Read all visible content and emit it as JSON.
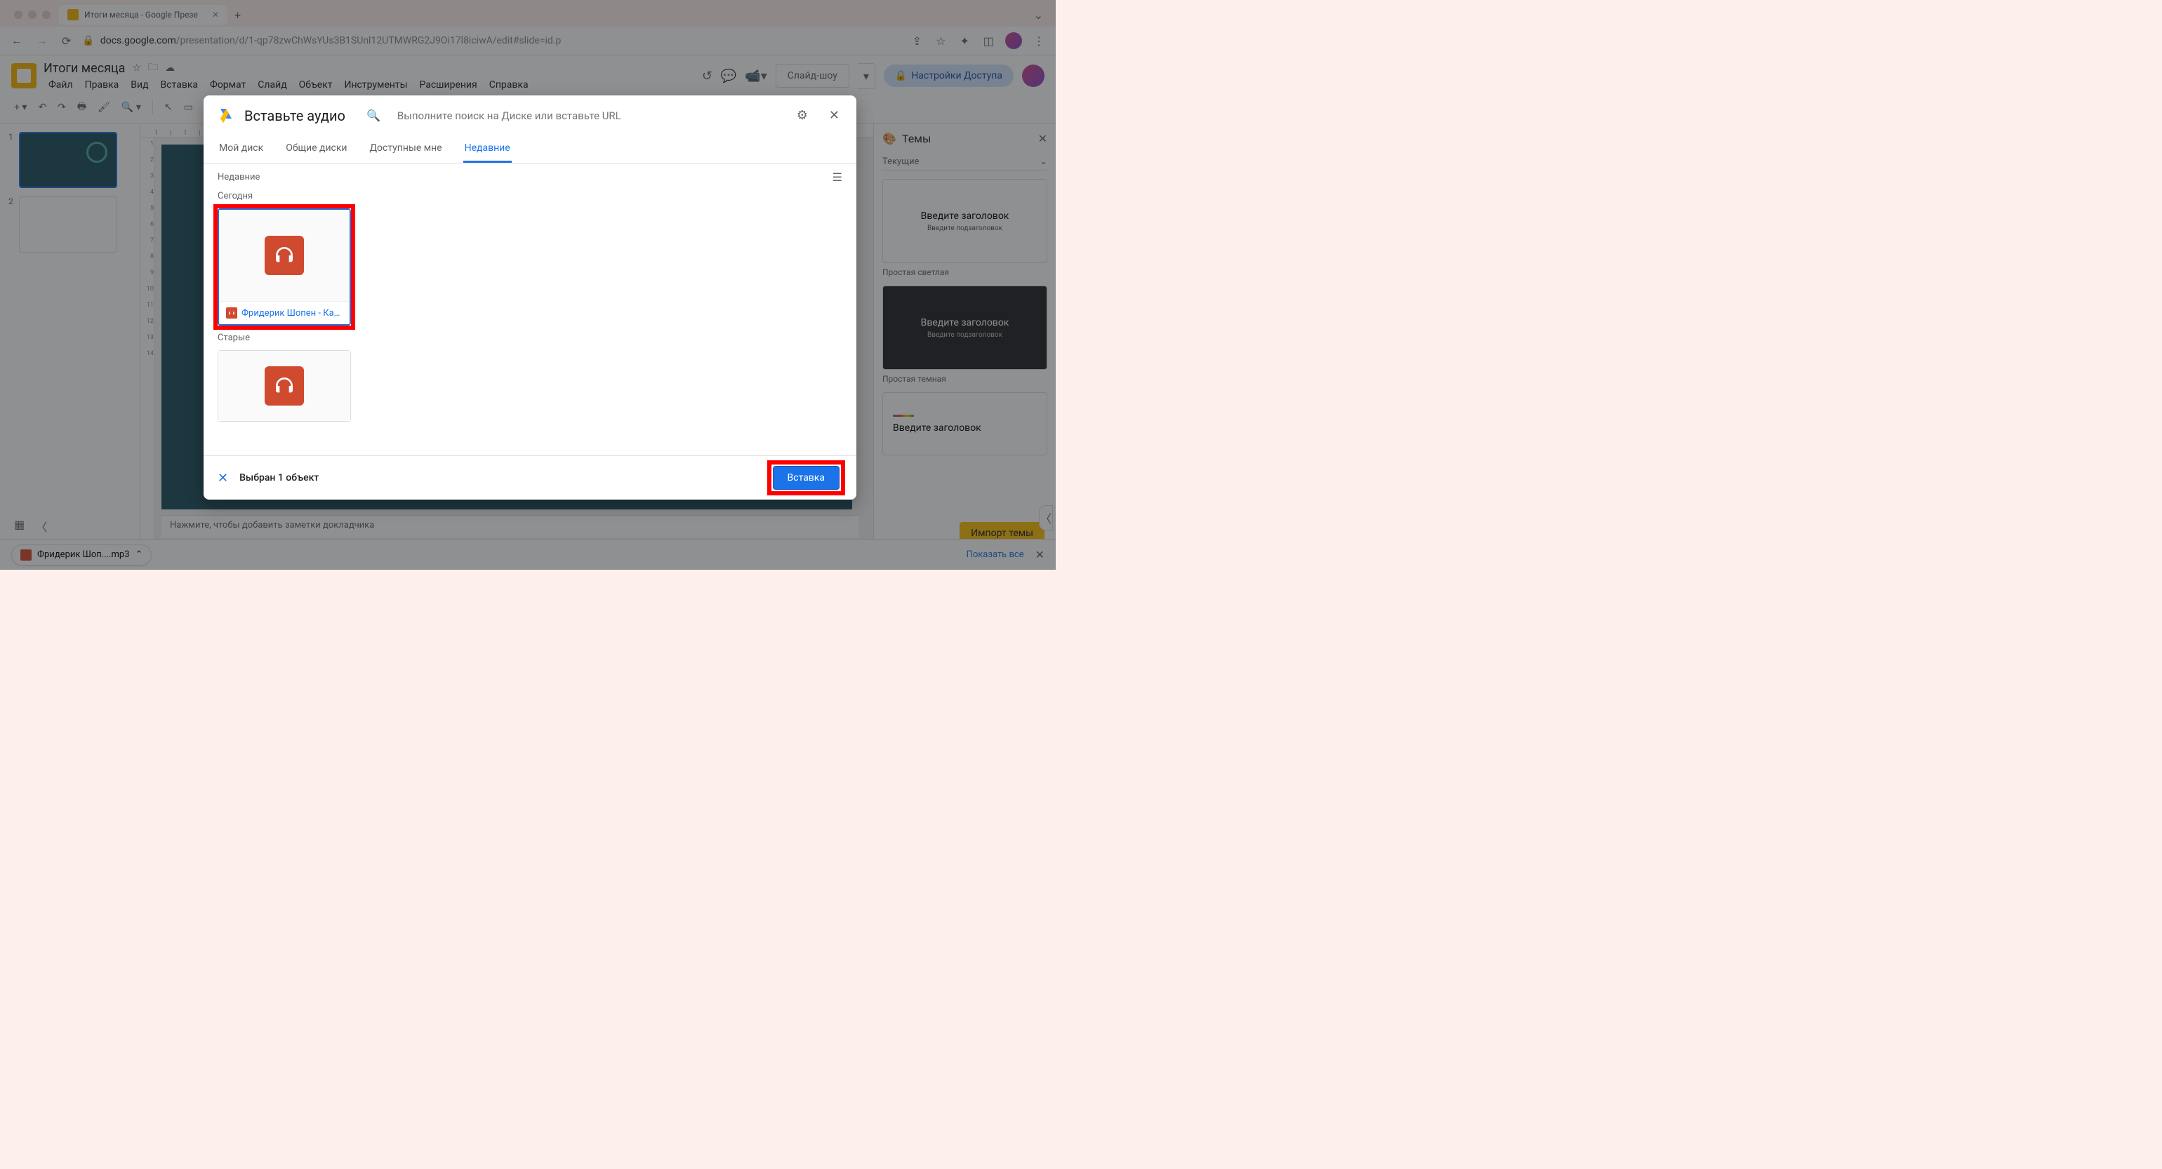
{
  "browser": {
    "tab_title": "Итоги месяца - Google Презе",
    "url_host": "docs.google.com",
    "url_path": "/presentation/d/1-qp78zwChWsYUs3B1SUnl12UTMWRG2J9Oi17l8iciwA/edit#slide=id.p"
  },
  "app": {
    "doc_title": "Итоги месяца",
    "menu": [
      "Файл",
      "Правка",
      "Вид",
      "Вставка",
      "Формат",
      "Слайд",
      "Объект",
      "Инструменты",
      "Расширения",
      "Справка"
    ],
    "slideshow": "Слайд-шоу",
    "share": "Настройки Доступа"
  },
  "themes": {
    "title": "Темы",
    "current": "Текущие",
    "card1_title": "Введите заголовок",
    "card1_sub": "Введите подзаголовок",
    "label1": "Простая светлая",
    "card2_title": "Введите заголовок",
    "card2_sub": "Введите подзаголовок",
    "label2": "Простая темная",
    "card3_title": "Введите заголовок",
    "import": "Импорт темы"
  },
  "speaker_notes": "Нажмите, чтобы добавить заметки докладчика",
  "dialog": {
    "title": "Вставьте аудио",
    "search_placeholder": "Выполните поиск на Диске или вставьте URL",
    "tabs": [
      "Мой диск",
      "Общие диски",
      "Доступные мне",
      "Недавние"
    ],
    "section_recent": "Недавние",
    "today": "Сегодня",
    "old": "Старые",
    "file1": "Фридерик Шопен - Ка…",
    "selection": "Выбран 1 объект",
    "insert": "Вставка"
  },
  "download": {
    "filename": "Фридерик Шоп....mp3",
    "show_all": "Показать все"
  }
}
